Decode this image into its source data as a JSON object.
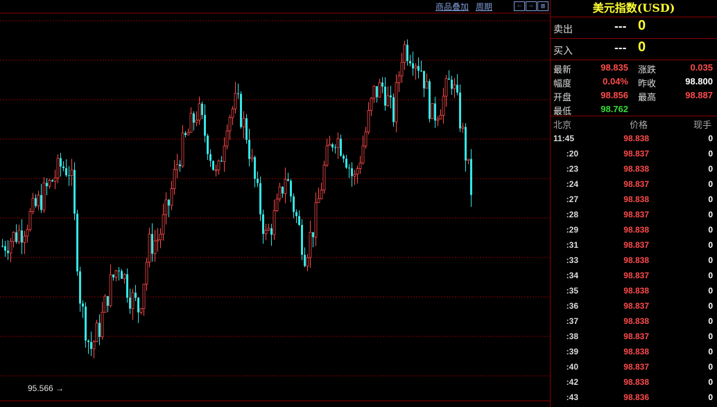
{
  "toolbar": {
    "overlay_label": "商品叠加",
    "period_label": "周期"
  },
  "chart": {
    "low_label": "95.566",
    "up_color": "#ff4b4b",
    "down_color": "#33e6e6",
    "grid_color": "#8b0000"
  },
  "panel": {
    "title": "美元指数(USD)",
    "sell": {
      "label": "卖出",
      "price": "---",
      "volume": "0"
    },
    "buy": {
      "label": "买入",
      "price": "---",
      "volume": "0"
    },
    "stats": [
      {
        "l1": "最新",
        "v1": "98.835",
        "c1": "red",
        "l2": "涨跌",
        "v2": "0.035",
        "c2": "red"
      },
      {
        "l1": "幅度",
        "v1": "0.04%",
        "c1": "red",
        "l2": "昨收",
        "v2": "98.800",
        "c2": "white"
      },
      {
        "l1": "开盘",
        "v1": "98.856",
        "c1": "red",
        "l2": "最高",
        "v2": "98.887",
        "c2": "red"
      },
      {
        "l1": "最低",
        "v1": "98.762",
        "c1": "green",
        "l2": "",
        "v2": "",
        "c2": "white"
      }
    ],
    "ticks_header": {
      "time": "北京",
      "price": "价格",
      "qty": "现手"
    },
    "ticks": [
      {
        "time": "11:45",
        "price": "98.838",
        "qty": "0"
      },
      {
        "time": ":20",
        "price": "98.837",
        "qty": "0"
      },
      {
        "time": ":23",
        "price": "98.838",
        "qty": "0"
      },
      {
        "time": ":24",
        "price": "98.837",
        "qty": "0"
      },
      {
        "time": ":27",
        "price": "98.838",
        "qty": "0"
      },
      {
        "time": ":28",
        "price": "98.837",
        "qty": "0"
      },
      {
        "time": ":29",
        "price": "98.838",
        "qty": "0"
      },
      {
        "time": ":31",
        "price": "98.837",
        "qty": "0"
      },
      {
        "time": ":33",
        "price": "98.838",
        "qty": "0"
      },
      {
        "time": ":34",
        "price": "98.837",
        "qty": "0"
      },
      {
        "time": ":35",
        "price": "98.838",
        "qty": "0"
      },
      {
        "time": ":36",
        "price": "98.837",
        "qty": "0"
      },
      {
        "time": ":37",
        "price": "98.838",
        "qty": "0"
      },
      {
        "time": ":38",
        "price": "98.837",
        "qty": "0"
      },
      {
        "time": ":39",
        "price": "98.838",
        "qty": "0"
      },
      {
        "time": ":40",
        "price": "98.837",
        "qty": "0"
      },
      {
        "time": ":42",
        "price": "98.838",
        "qty": "0"
      },
      {
        "time": ":43",
        "price": "98.836",
        "qty": "0"
      }
    ]
  },
  "chart_data": {
    "type": "candlestick",
    "title": "",
    "low_marker": 95.566,
    "close_path": [
      96.9,
      97.0,
      97.1,
      97.3,
      97.5,
      97.7,
      97.9,
      97.85,
      96.2,
      95.6,
      95.9,
      96.4,
      96.7,
      96.3,
      96.1,
      96.9,
      97.0,
      97.4,
      98.0,
      98.3,
      98.6,
      98.2,
      97.7,
      98.5,
      98.7,
      98.3,
      97.6,
      97.0,
      97.3,
      97.8,
      97.3,
      96.8,
      97.2,
      97.9,
      98.3,
      98.1,
      97.7,
      98.2,
      98.8,
      98.9,
      98.5,
      99.4,
      99.3,
      99.1,
      98.5,
      98.7,
      99.0,
      98.4,
      97.6
    ]
  }
}
